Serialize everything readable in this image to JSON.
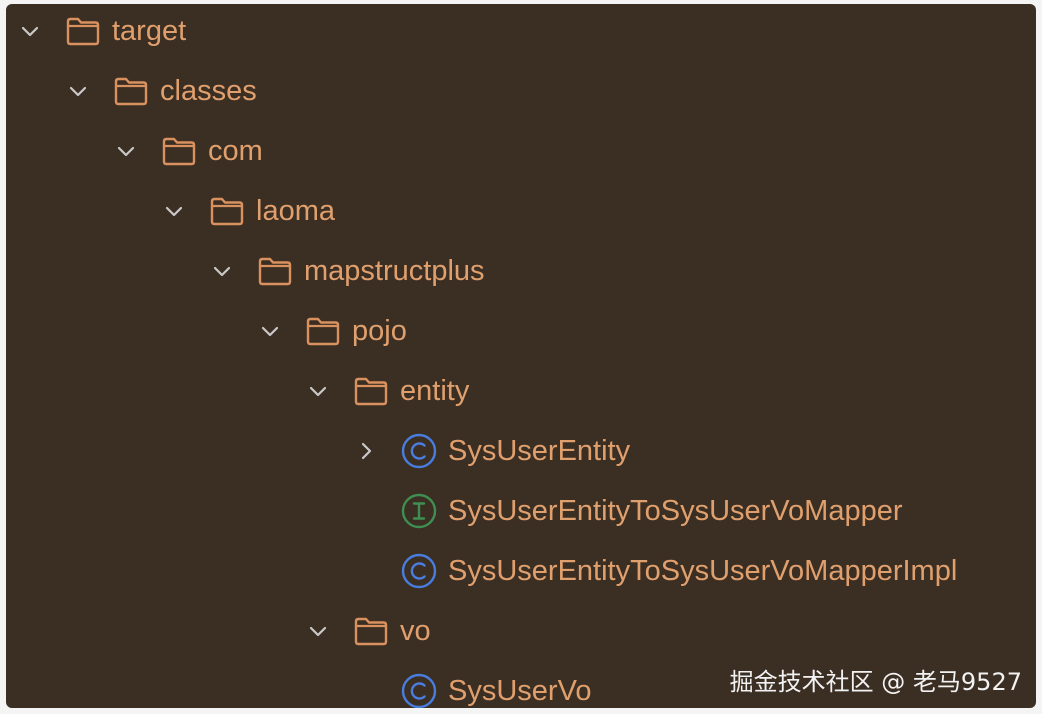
{
  "tree": {
    "nodes": [
      {
        "label": "target",
        "kind": "folder",
        "expanded": true,
        "depth": 0
      },
      {
        "label": "classes",
        "kind": "folder",
        "expanded": true,
        "depth": 1
      },
      {
        "label": "com",
        "kind": "folder",
        "expanded": true,
        "depth": 2
      },
      {
        "label": "laoma",
        "kind": "folder",
        "expanded": true,
        "depth": 3
      },
      {
        "label": "mapstructplus",
        "kind": "folder",
        "expanded": true,
        "depth": 4
      },
      {
        "label": "pojo",
        "kind": "folder",
        "expanded": true,
        "depth": 5
      },
      {
        "label": "entity",
        "kind": "folder",
        "expanded": true,
        "depth": 6
      },
      {
        "label": "SysUserEntity",
        "kind": "class",
        "expanded": false,
        "depth": 7,
        "has_children": true
      },
      {
        "label": "SysUserEntityToSysUserVoMapper",
        "kind": "interface",
        "depth": 7
      },
      {
        "label": "SysUserEntityToSysUserVoMapperImpl",
        "kind": "class",
        "depth": 7
      },
      {
        "label": "vo",
        "kind": "folder",
        "expanded": true,
        "depth": 6
      },
      {
        "label": "SysUserVo",
        "kind": "class",
        "depth": 7
      }
    ]
  },
  "icons": {
    "folder": "folder-icon",
    "class": "class-c-icon",
    "interface": "interface-i-icon",
    "expanded": "chevron-down-icon",
    "collapsed": "chevron-right-icon"
  },
  "colors": {
    "background": "#3b2e23",
    "label": "#e0a06e",
    "folder_icon": "#d9925f",
    "class_icon": "#4a7de0",
    "interface_icon": "#3f8f52",
    "chevron": "#c9c9c9"
  },
  "watermark": {
    "text": "掘金技术社区 @ 老马9527"
  }
}
